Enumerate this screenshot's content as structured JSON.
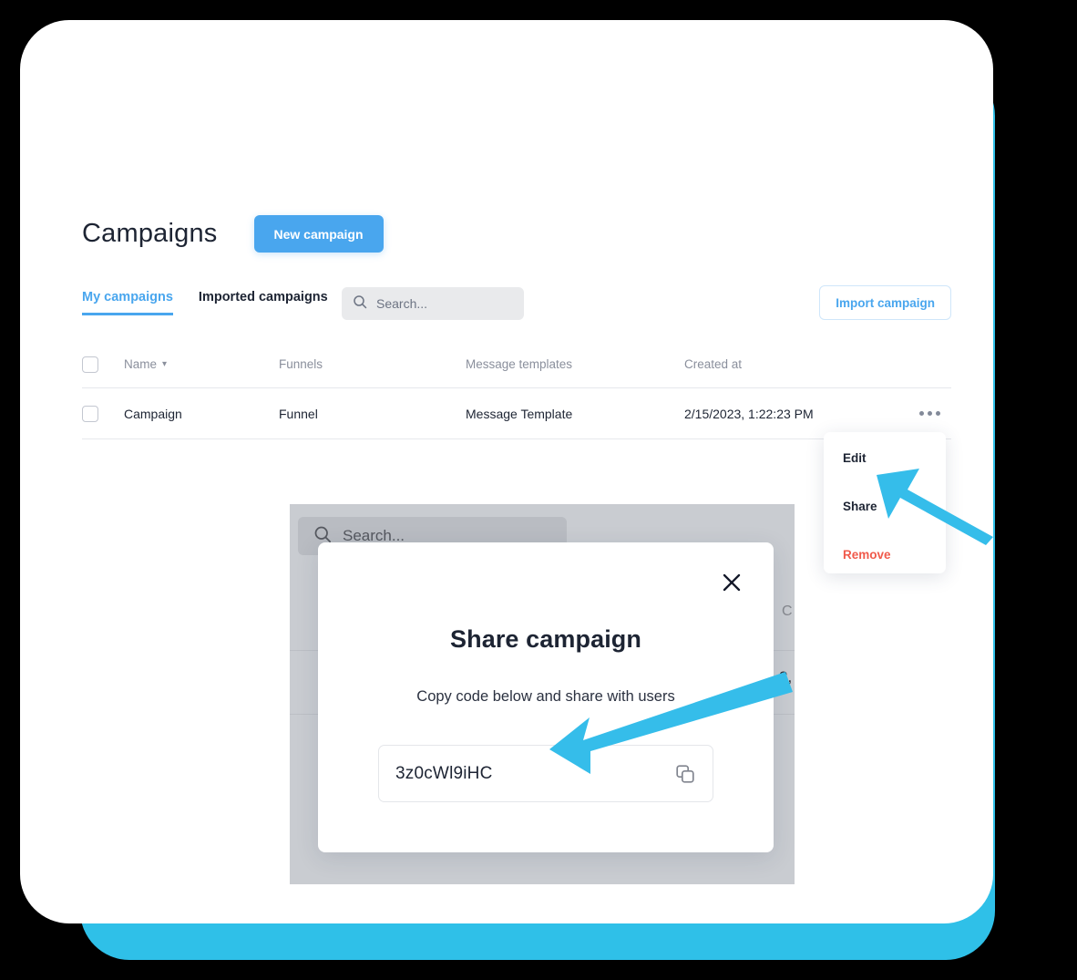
{
  "theme": {
    "accent_blue": "#49a6ee",
    "accent_teal": "#2fc0e8",
    "danger_red": "#f05a4b",
    "arrow_color": "#35bdea"
  },
  "header": {
    "title": "Campaigns",
    "new_campaign_label": "New campaign"
  },
  "toolbar": {
    "tabs": [
      {
        "label": "My campaigns",
        "active": true
      },
      {
        "label": "Imported campaigns",
        "active": false
      }
    ],
    "search": {
      "placeholder": "Search...",
      "value": ""
    },
    "import_label": "Import campaign"
  },
  "table": {
    "columns": [
      "Name",
      "Funnels",
      "Message templates",
      "Created at"
    ],
    "rows": [
      {
        "name": "Campaign",
        "funnels": "Funnel",
        "message_templates": "Message Template",
        "created_at": "2/15/2023, 1:22:23 PM"
      }
    ]
  },
  "context_menu": {
    "items": [
      {
        "label": "Edit",
        "danger": false
      },
      {
        "label": "Share",
        "danger": false
      },
      {
        "label": "Remove",
        "danger": true
      }
    ]
  },
  "inner_screenshot": {
    "search_placeholder": "Search...",
    "partial_column_header": "C",
    "partial_cell_value": "2,"
  },
  "modal": {
    "title": "Share campaign",
    "subtitle": "Copy code below and share with users",
    "code_value": "3z0cWl9iHC",
    "close_label": "×"
  }
}
